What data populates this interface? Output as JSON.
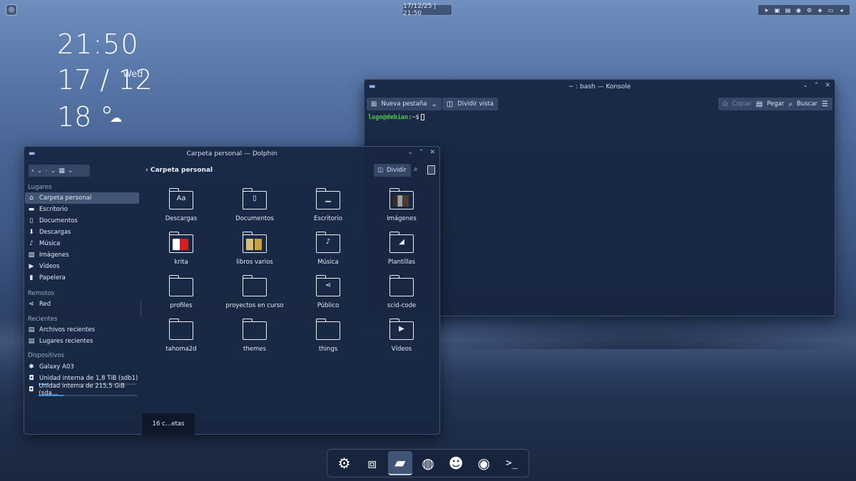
{
  "panel": {
    "clock": "17/12/25 | 21:50"
  },
  "widget": {
    "time": "21:50",
    "date": "17 / 12",
    "weekday": "Wed",
    "temperature": "18 °"
  },
  "konsole": {
    "title": "~ : bash — Konsole",
    "toolbar": {
      "new_tab": "Nueva pestaña",
      "split_view": "Dividir vista",
      "copy": "Copiar",
      "paste": "Pegar",
      "search": "Buscar"
    },
    "prompt_user": "lugo@debian",
    "prompt_rest": ":~$"
  },
  "dolphin": {
    "title": "Carpeta personal — Dolphin",
    "breadcrumb": "Carpeta personal",
    "split_label": "Dividir",
    "status": "16 c…etas",
    "sidebar": {
      "places_header": "Lugares",
      "places": [
        "Carpeta personal",
        "Escritorio",
        "Documentos",
        "Descargas",
        "Música",
        "Imágenes",
        "Vídeos",
        "Papelera"
      ],
      "remote_header": "Remotos",
      "remote": [
        "Red"
      ],
      "recent_header": "Recientes",
      "recent": [
        "Archivos recientes",
        "Lugares recientes"
      ],
      "devices_header": "Dispositivos",
      "devices": [
        "Galaxy A03",
        "Unidad interna de 1,8 TiB (sdb1)",
        "Unidad interna de 215,5 GiB (sda…"
      ],
      "device_usage": [
        null,
        0.1,
        0.25
      ]
    },
    "folders": [
      "Descargas",
      "Documentos",
      "Escritorio",
      "Imágenes",
      "krita",
      "libros varios",
      "Música",
      "Plantillas",
      "profiles",
      "proyectos en curso",
      "Público",
      "scid-code",
      "tahoma2d",
      "themes",
      "things",
      "Vídeos"
    ],
    "folder_icons": [
      "fonts-preview",
      "document-icon",
      "desktop-icon",
      "image-thumbnails",
      "krita-thumbnails",
      "book-thumbnails",
      "music-icon",
      "template-icon",
      "plain",
      "plain",
      "share-icon",
      "plain",
      "plain",
      "plain",
      "plain",
      "video-icon"
    ]
  },
  "dock": [
    "settings-icon",
    "toolbox-icon",
    "file-manager-icon",
    "browser-icon",
    "discord-icon",
    "steam-icon",
    "terminal-icon"
  ]
}
